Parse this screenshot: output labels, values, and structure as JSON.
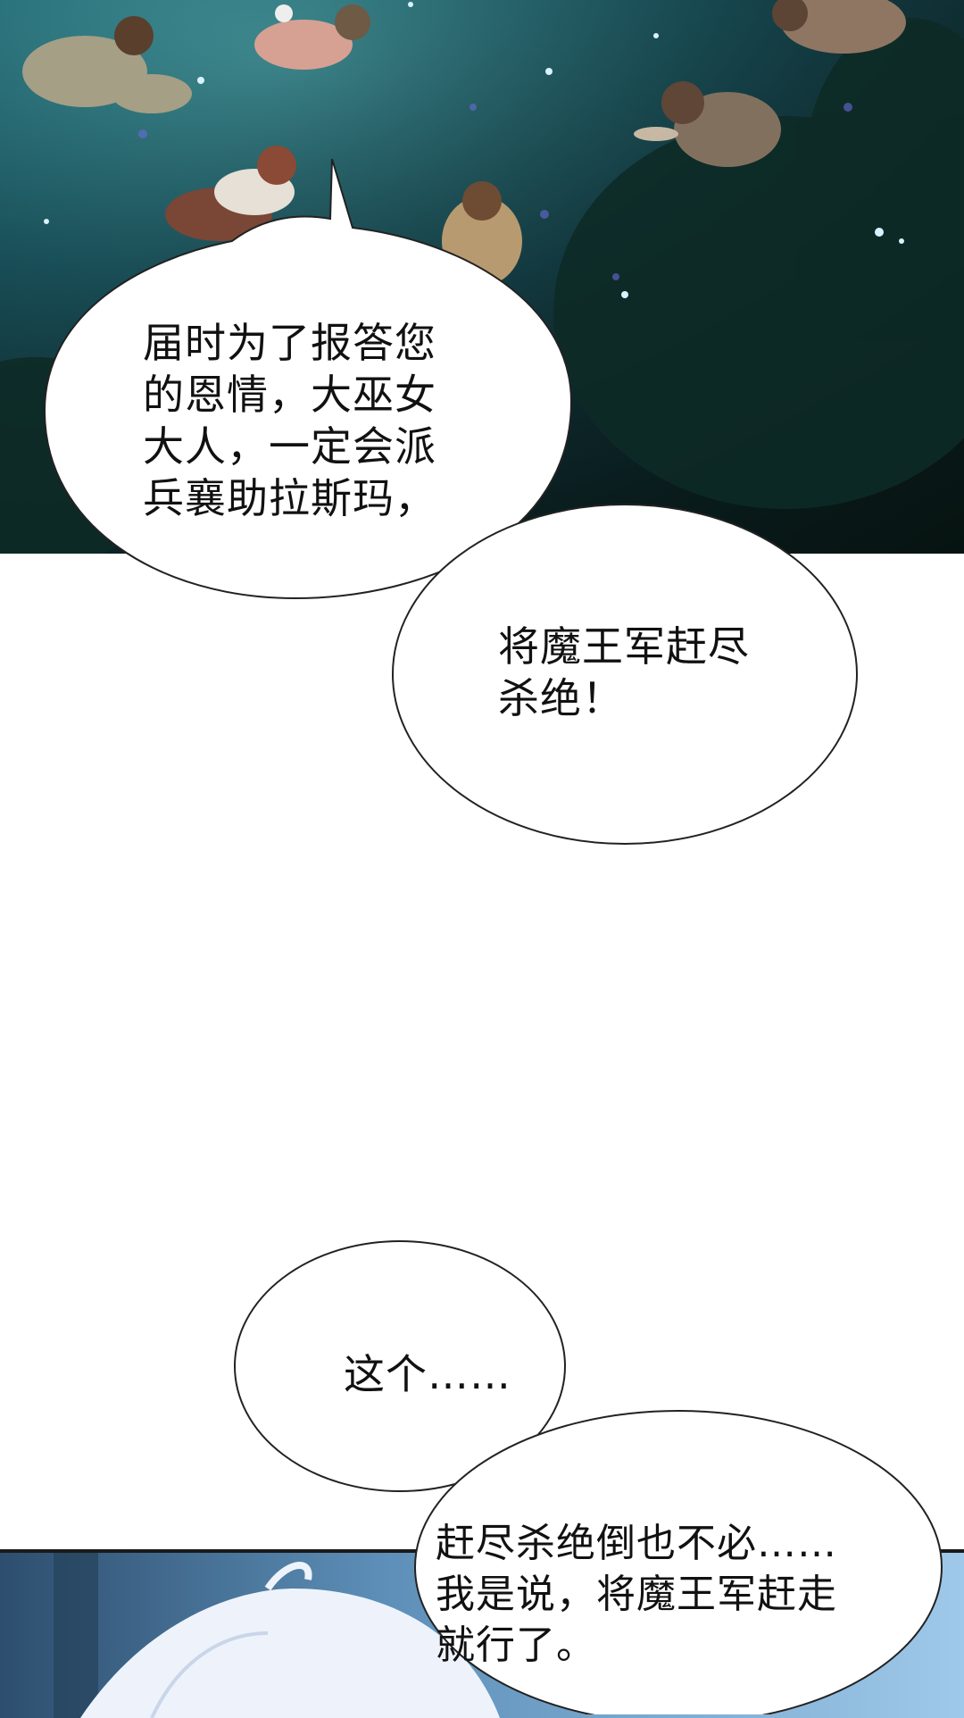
{
  "panels": {
    "top": {
      "description": "night grass field with kneeling villagers"
    },
    "bottom": {
      "description": "white-haired character glowing"
    }
  },
  "dialogue": [
    {
      "id": "bubble-1",
      "text": "届时为了报答您\n的恩情，大巫女\n大人，一定会派\n兵襄助拉斯玛，"
    },
    {
      "id": "bubble-2",
      "text": "将魔王军赶尽\n杀绝！"
    },
    {
      "id": "bubble-3",
      "text": "这个……"
    },
    {
      "id": "bubble-4",
      "text": "赶尽杀绝倒也不必……\n我是说，将魔王军赶走\n就行了。"
    }
  ],
  "colors": {
    "grass_dark": "#0f2f34",
    "grass_mid": "#1f5e6a",
    "grass_light": "#3f8c93",
    "bubble_fill": "#ffffff",
    "bubble_stroke": "#222222"
  }
}
